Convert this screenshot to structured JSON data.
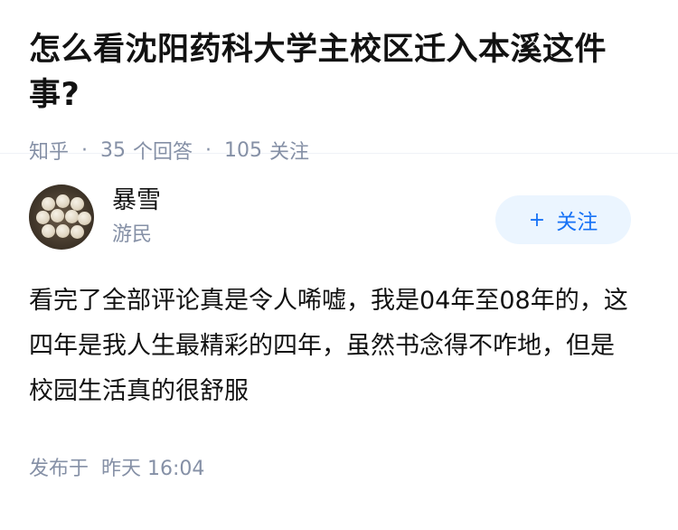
{
  "question": {
    "title": "怎么看沈阳药科大学主校区迁入本溪这件事?",
    "source": "知乎",
    "separator": "·",
    "answer_count": "35",
    "answer_label": "个回答",
    "follower_count": "105",
    "follower_label": "关注"
  },
  "answer": {
    "author_name": "暴雪",
    "author_badge": "游民",
    "follow_plus": "+",
    "follow_label": "关注",
    "content": "看完了全部评论真是令人唏嘘，我是04年至08年的，这四年是我人生最精彩的四年，虽然书念得不咋地，但是校园生活真的很舒服",
    "published_label": "发布于",
    "published_time": "昨天 16:04"
  }
}
